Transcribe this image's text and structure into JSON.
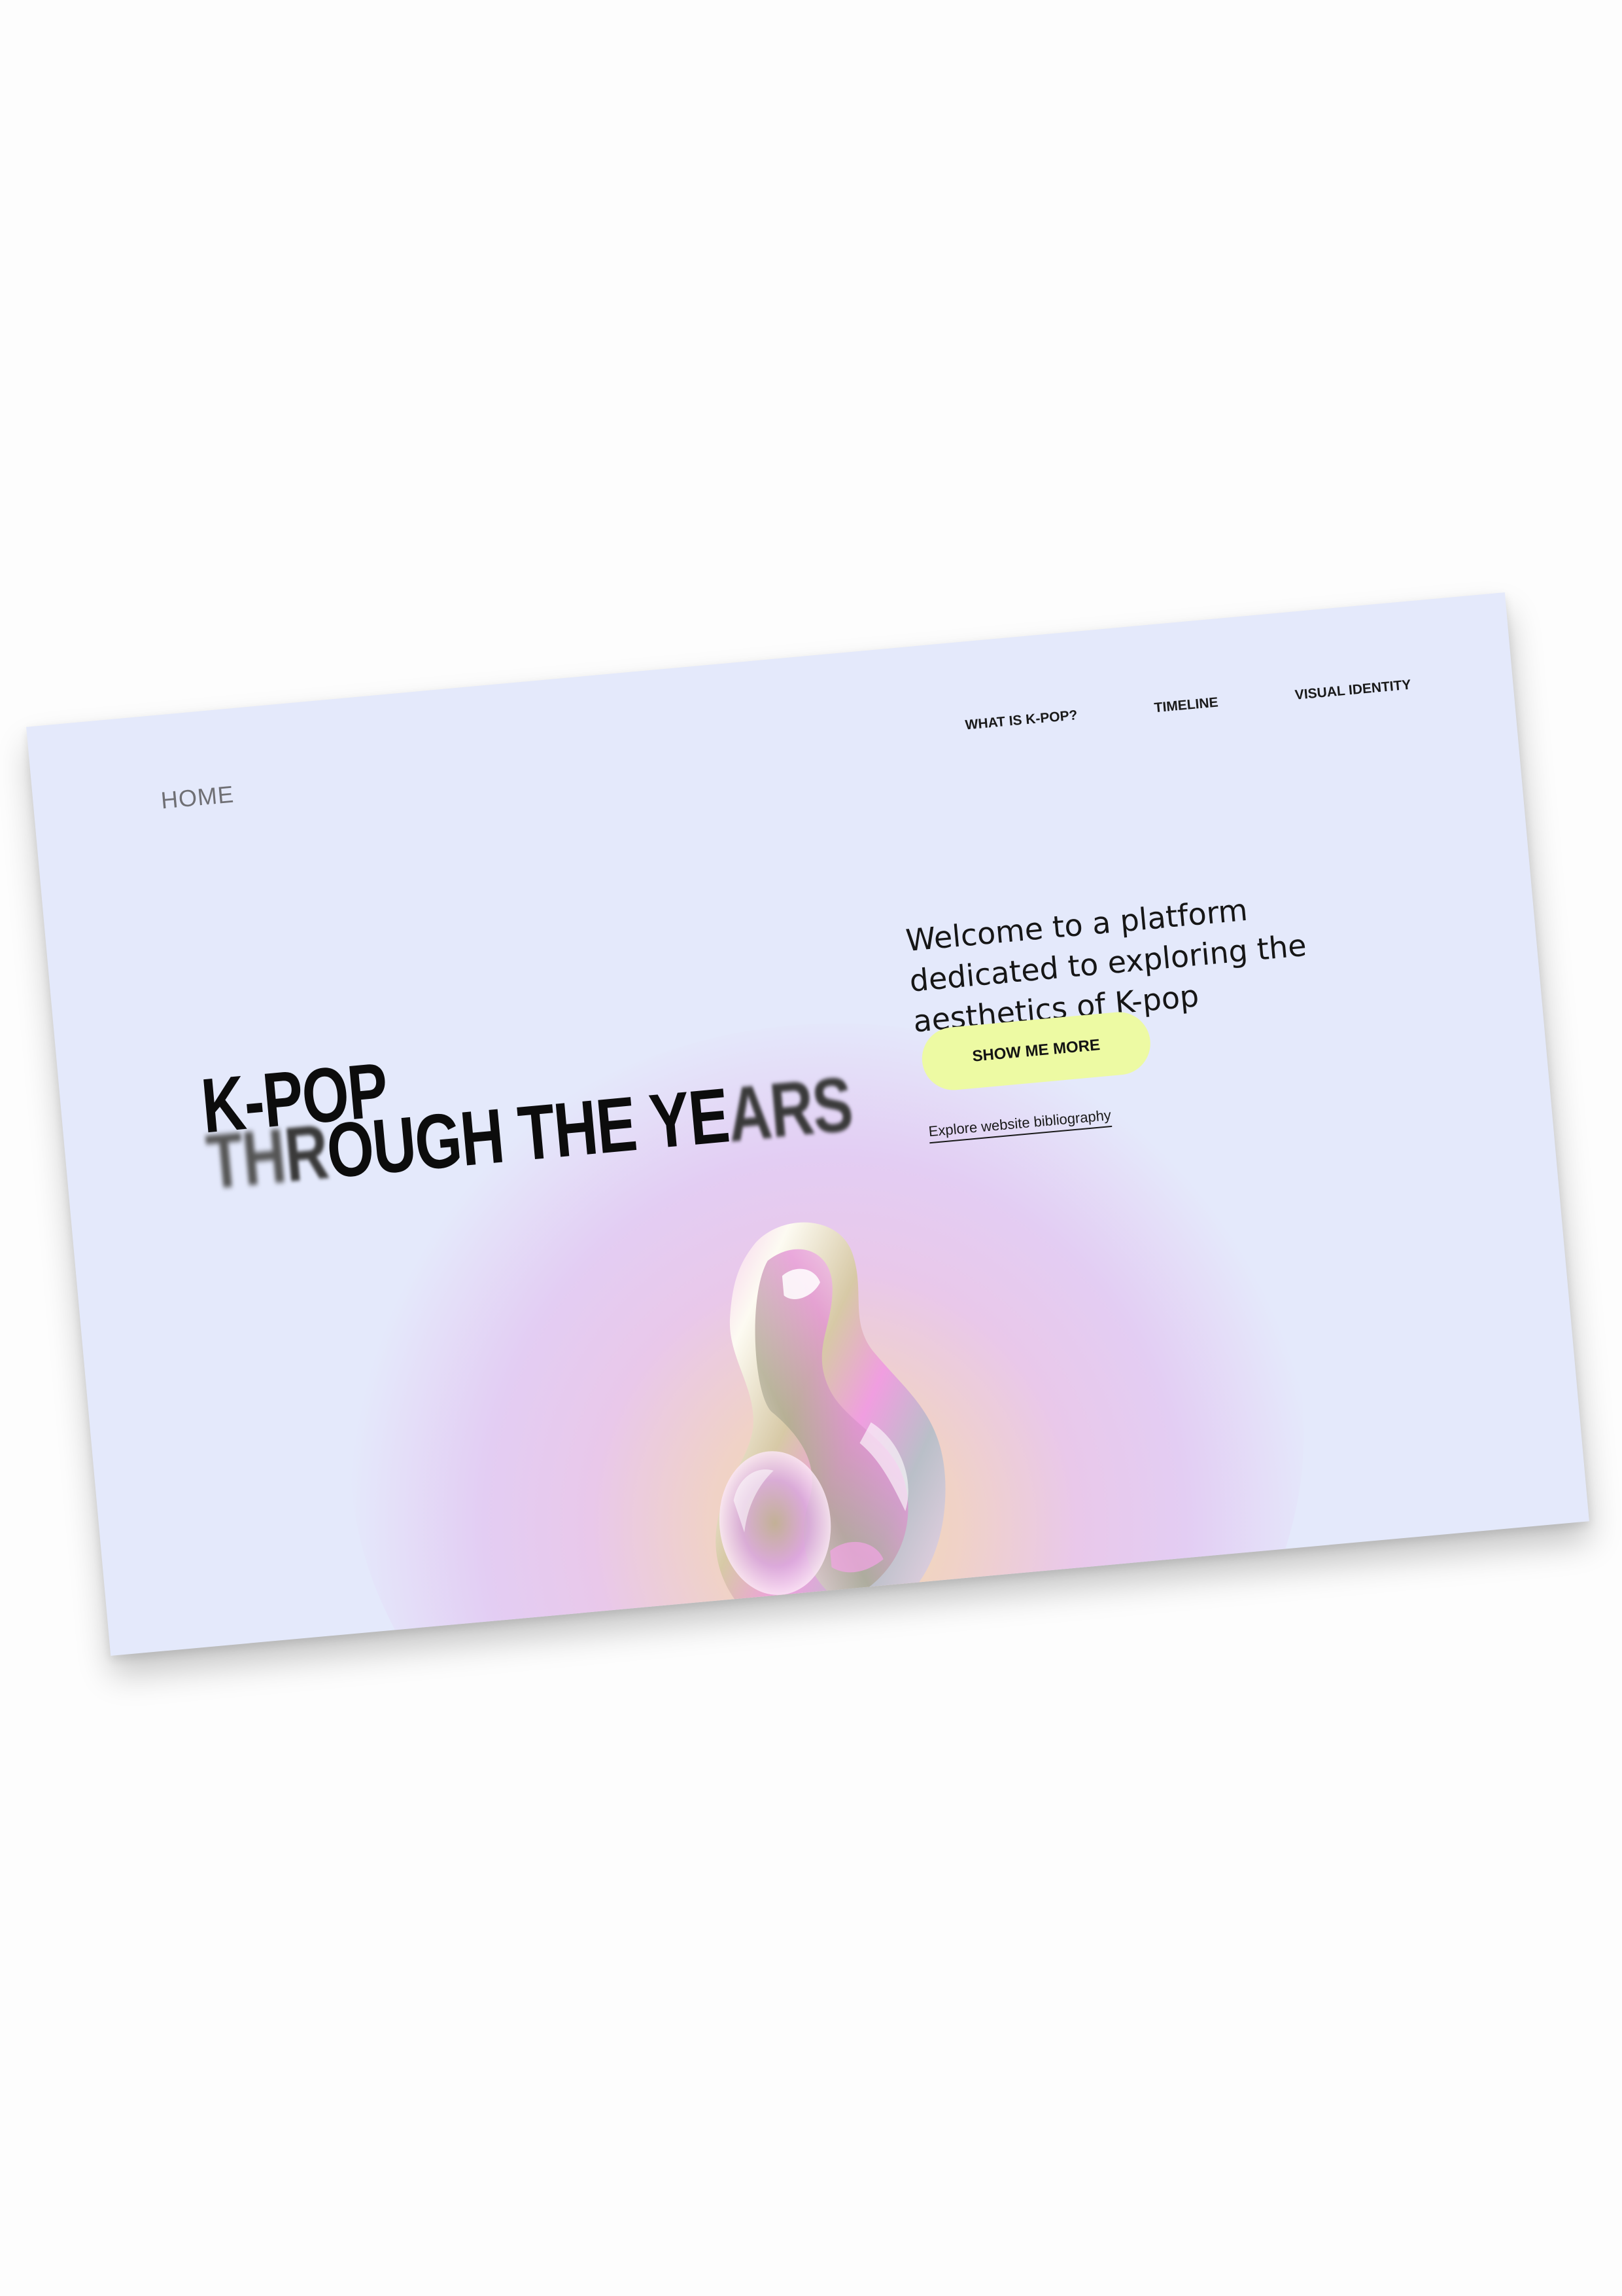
{
  "nav": {
    "home": "HOME",
    "links": [
      "WHAT IS K-POP?",
      "TIMELINE",
      "VISUAL IDENTITY"
    ]
  },
  "hero": {
    "title_line1": "K-POP",
    "title_line2_blurred_a": "TH",
    "title_line2_blurred_b": "R",
    "title_line2_main": "OUGH THE YE",
    "title_line2_blurred_end": "ARS",
    "welcome": "Welcome to a platform dedicated to exploring the aesthetics of K-pop",
    "cta_label": "SHOW ME MORE",
    "bibliography_link": "Explore website bibliography"
  },
  "colors": {
    "page_bg": "#e4e9fb",
    "cta_bg": "#edfaa3",
    "glow": "#e3cdf3"
  },
  "icons": {
    "hero_object": "iridescent-liquid-chrome-blob"
  }
}
